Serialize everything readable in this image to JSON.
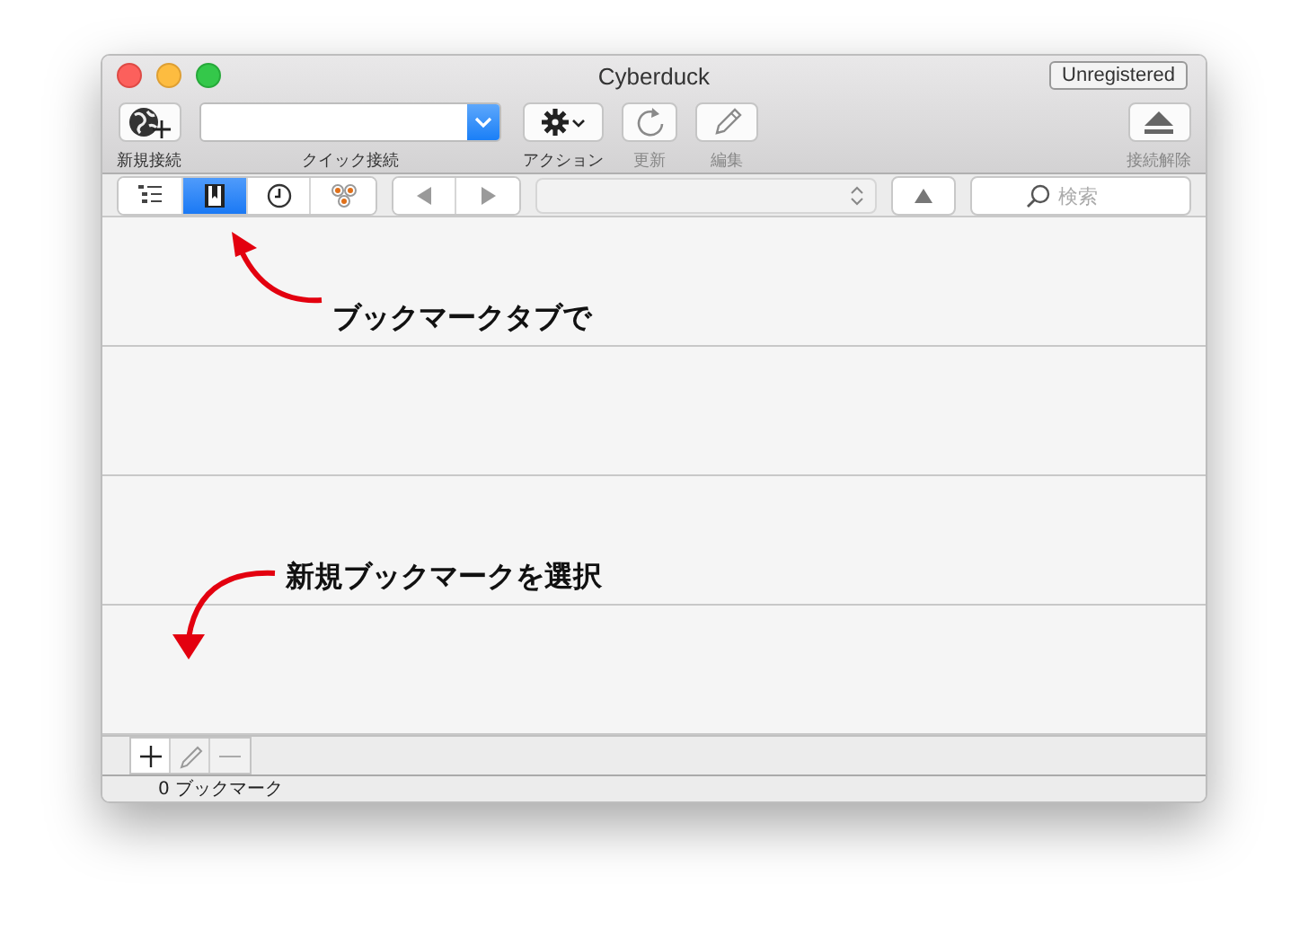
{
  "window": {
    "title": "Cyberduck",
    "badge": "Unregistered"
  },
  "toolbar": [
    {
      "kind": "globe",
      "label": "新規接続",
      "disabled": false
    },
    {
      "kind": "field",
      "label": "クイック接続",
      "disabled": false
    },
    {
      "kind": "gear",
      "label": "アクション",
      "disabled": false
    },
    {
      "kind": "refresh",
      "label": "更新",
      "disabled": true
    },
    {
      "kind": "pencil",
      "label": "編集",
      "disabled": true
    },
    {
      "kind": "eject",
      "label": "接続解除",
      "disabled": true
    }
  ],
  "view_tabs": [
    {
      "kind": "outline",
      "selected": false
    },
    {
      "kind": "bookmark",
      "selected": true
    },
    {
      "kind": "clock",
      "selected": false
    },
    {
      "kind": "bonjour",
      "selected": false
    }
  ],
  "nav": {
    "back_disabled": true,
    "forward_disabled": true
  },
  "search": {
    "placeholder": "検索"
  },
  "annotations": [
    {
      "text": "ブックマークタブで",
      "kind": "up"
    },
    {
      "text": "新規ブックマークを選択",
      "kind": "down"
    }
  ],
  "bottom_buttons": [
    {
      "kind": "add",
      "disabled": false
    },
    {
      "kind": "pencil",
      "disabled": true
    },
    {
      "kind": "remove",
      "disabled": true
    }
  ],
  "status_bar": "0 ブックマーク"
}
